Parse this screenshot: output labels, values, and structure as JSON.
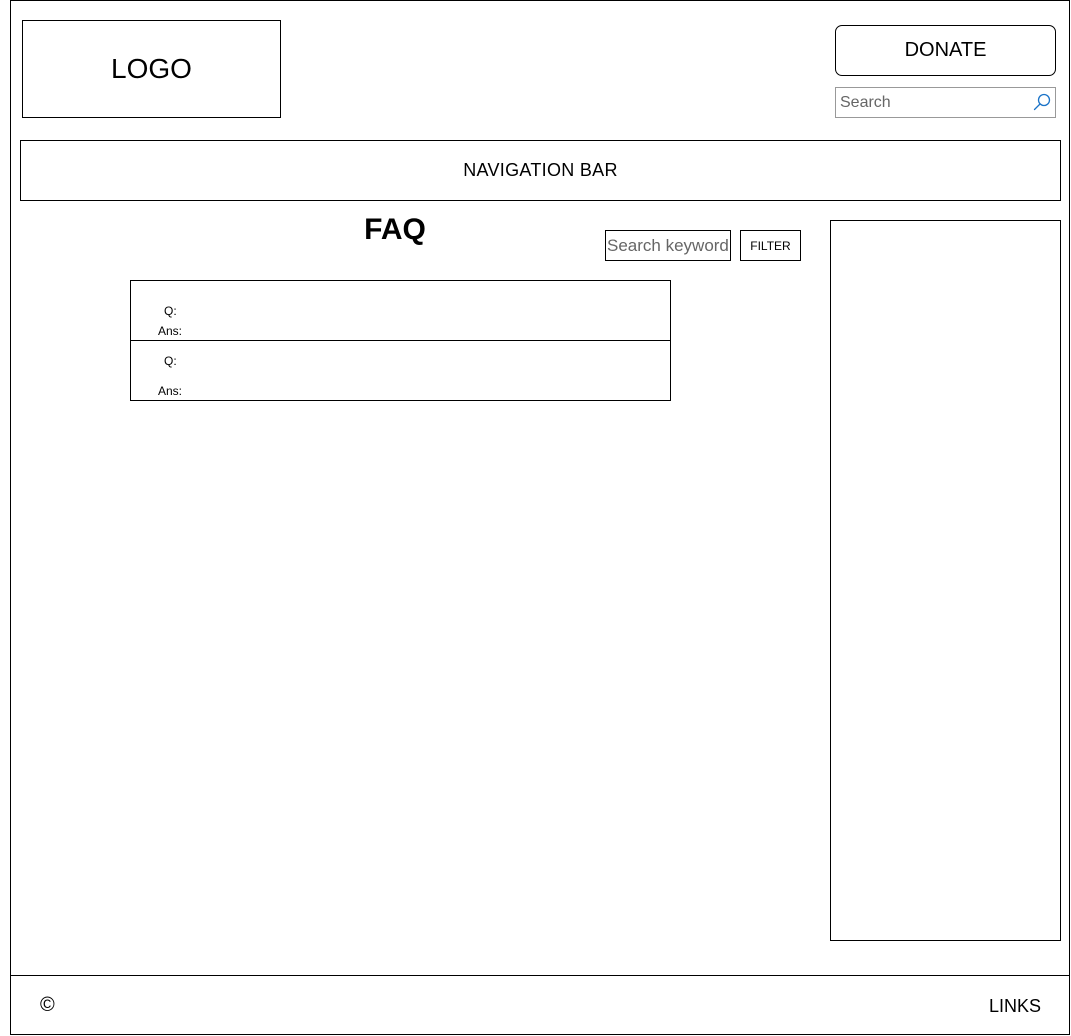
{
  "header": {
    "logo_text": "LOGO",
    "donate_label": "DONATE",
    "search_placeholder": "Search",
    "search_icon": "search-icon",
    "search_icon_color": "#1a73c8"
  },
  "navigation": {
    "label": "NAVIGATION BAR"
  },
  "main": {
    "title": "FAQ",
    "keyword_placeholder": "Search keyword",
    "filter_label": "FILTER",
    "faq_items": [
      {
        "question_label": "Q:",
        "answer_label": "Ans:"
      },
      {
        "question_label": "Q:",
        "answer_label": "Ans:"
      }
    ]
  },
  "footer": {
    "copyright_symbol": "©",
    "links_label": "LINKS"
  }
}
